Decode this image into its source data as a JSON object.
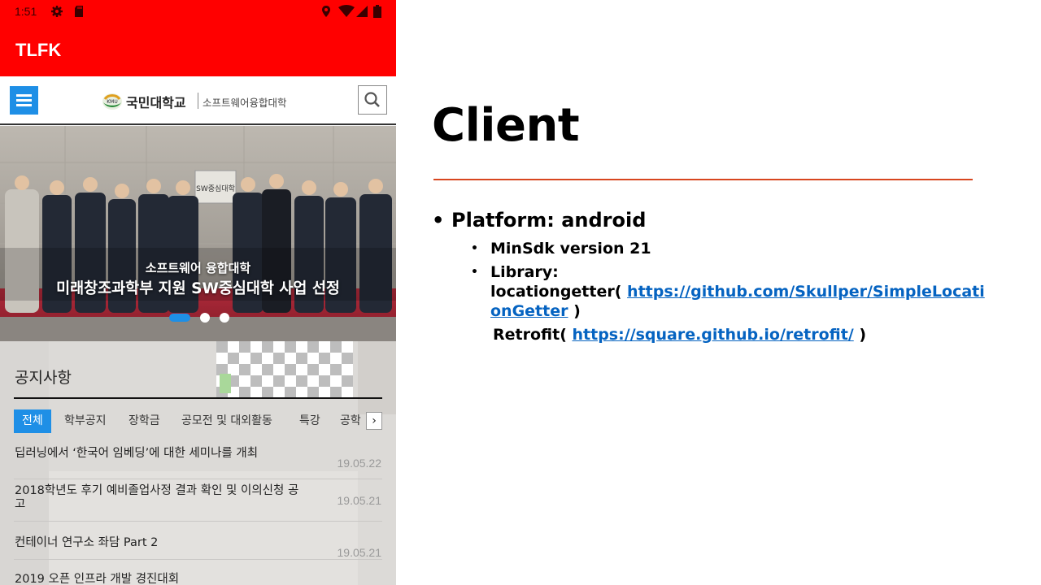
{
  "phone": {
    "status": {
      "time": "1:51"
    },
    "app_title": "TLFK",
    "site": {
      "logo_univ": "국민대학교",
      "logo_college": "소프트웨어융합대학",
      "logo_emblem_text": "KMU"
    },
    "hero": {
      "caption_line1": "소프트웨어 융합대학",
      "caption_line2": "미래창조과학부 지원 SW중심대학 사업 선정",
      "sign_text": "SW중심대학"
    },
    "notice": {
      "title": "공지사항",
      "tabs": [
        "전체",
        "학부공지",
        "장학금",
        "공모전 및 대외활동",
        "특강",
        "공학"
      ],
      "next_glyph": "›",
      "items": [
        {
          "title": "딥러닝에서 ‘한국어 임베딩’에 대한 세미나를 개최",
          "date": "19.05.22"
        },
        {
          "title": "2018학년도 후기 예비졸업사정 결과 확인 및 이의신청 공고",
          "date": "19.05.21"
        },
        {
          "title": "컨테이너 연구소 좌담 Part 2",
          "date": "19.05.21"
        },
        {
          "title": "2019 오픈 인프라 개발 경진대회",
          "date": ""
        }
      ]
    }
  },
  "slide": {
    "title": "Client",
    "accent_color": "#d8461f",
    "bullets": {
      "platform": "Platform: android",
      "minsdk": "MinSdk version 21",
      "library_label": "Library:",
      "locationgetter_prefix": "locationgetter(",
      "locationgetter_link_line1": "https://github.com/Skullper/SimpleLocati",
      "locationgetter_link_line2": "onGetter",
      "locationgetter_suffix": ")",
      "retrofit_prefix": "Retrofit(",
      "retrofit_link": "https://square.github.io/retrofit/",
      "retrofit_suffix": ")"
    }
  }
}
